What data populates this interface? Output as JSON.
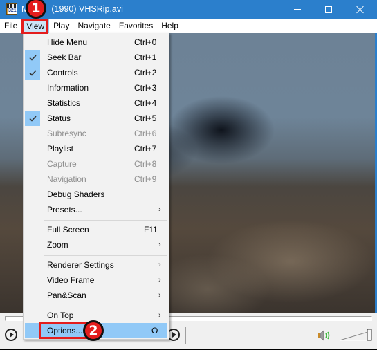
{
  "window": {
    "title_visible": "M",
    "title_rest": "(1990) VHSRip.avi",
    "app_icon_text": "321",
    "controls": {
      "minimize": "minimize",
      "maximize": "maximize",
      "close": "close"
    }
  },
  "menubar": {
    "items": [
      {
        "label": "File"
      },
      {
        "label": "View",
        "active": true
      },
      {
        "label": "Play"
      },
      {
        "label": "Navigate"
      },
      {
        "label": "Favorites"
      },
      {
        "label": "Help"
      }
    ]
  },
  "view_menu": {
    "items": [
      {
        "label": "Hide Menu",
        "shortcut": "Ctrl+0",
        "checked": false,
        "enabled": true
      },
      {
        "label": "Seek Bar",
        "shortcut": "Ctrl+1",
        "checked": true,
        "enabled": true
      },
      {
        "label": "Controls",
        "shortcut": "Ctrl+2",
        "checked": true,
        "enabled": true
      },
      {
        "label": "Information",
        "shortcut": "Ctrl+3",
        "checked": false,
        "enabled": true
      },
      {
        "label": "Statistics",
        "shortcut": "Ctrl+4",
        "checked": false,
        "enabled": true
      },
      {
        "label": "Status",
        "shortcut": "Ctrl+5",
        "checked": true,
        "enabled": true
      },
      {
        "label": "Subresync",
        "shortcut": "Ctrl+6",
        "checked": false,
        "enabled": false
      },
      {
        "label": "Playlist",
        "shortcut": "Ctrl+7",
        "checked": false,
        "enabled": true
      },
      {
        "label": "Capture",
        "shortcut": "Ctrl+8",
        "checked": false,
        "enabled": false
      },
      {
        "label": "Navigation",
        "shortcut": "Ctrl+9",
        "checked": false,
        "enabled": false
      },
      {
        "label": "Debug Shaders",
        "shortcut": "",
        "checked": false,
        "enabled": true
      },
      {
        "label": "Presets...",
        "shortcut": "",
        "submenu": true,
        "enabled": true
      },
      {
        "label": "Full Screen",
        "shortcut": "F11",
        "enabled": true
      },
      {
        "label": "Zoom",
        "shortcut": "",
        "submenu": true,
        "enabled": true
      },
      {
        "label": "Renderer Settings",
        "shortcut": "",
        "submenu": true,
        "enabled": true
      },
      {
        "label": "Video Frame",
        "shortcut": "",
        "submenu": true,
        "enabled": true
      },
      {
        "label": "Pan&Scan",
        "shortcut": "",
        "submenu": true,
        "enabled": true
      },
      {
        "label": "On Top",
        "shortcut": "",
        "submenu": true,
        "enabled": true
      },
      {
        "label": "Options...",
        "shortcut": "O",
        "highlighted": true,
        "enabled": true
      }
    ],
    "submenu_arrow": "›"
  },
  "annotations": {
    "step1": "1",
    "step2": "2",
    "color": "#e41d1d"
  },
  "player": {
    "seek_position": 0,
    "volume_icon": "speaker-icon"
  },
  "colors": {
    "titlebar": "#2b7fcc",
    "menu_highlight": "#91c9f7",
    "menu_bg": "#f2f2f2"
  }
}
